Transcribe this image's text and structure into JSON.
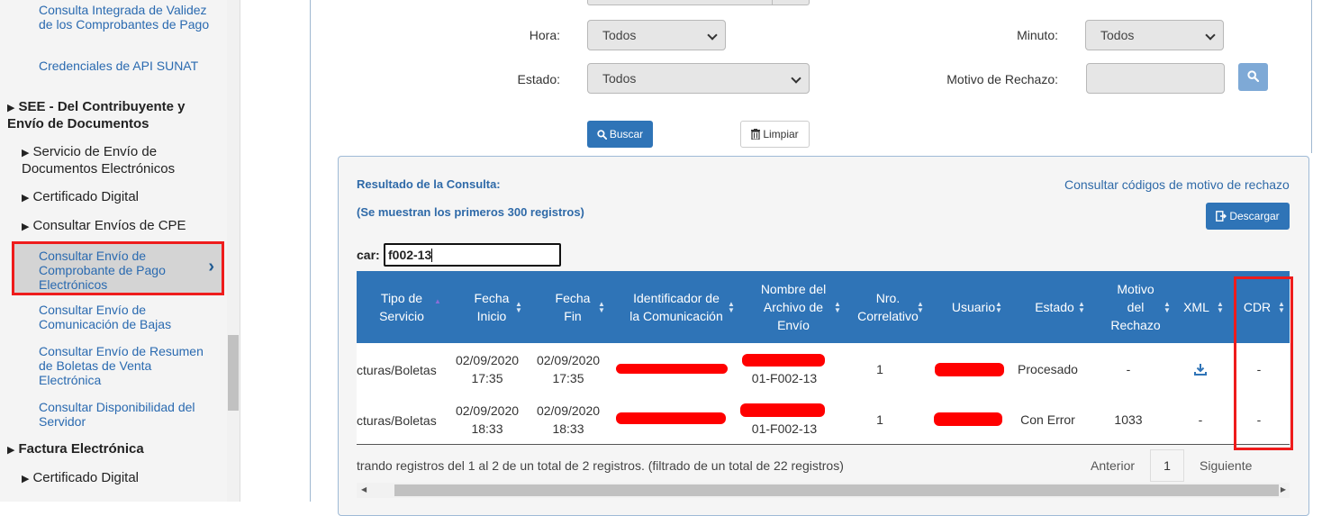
{
  "sidebar": {
    "link_validez": "Consulta Integrada de Validez de los Comprobantes de Pago",
    "link_credenciales": "Credenciales de API SUNAT",
    "section_see": "SEE - Del Contribuyente y Envío de Documentos",
    "item_servicio": "Servicio de Envío de Documentos Electrónicos",
    "item_certificado": "Certificado Digital",
    "item_consultar_envios": "Consultar Envíos de CPE",
    "active_item": "Consultar Envío de Comprobante de Pago Electrónicos",
    "link_bajas": "Consultar Envío de Comunicación de Bajas",
    "link_resumen": "Consultar Envío de Resumen de Boletas de Venta Electrónica",
    "link_disponibilidad": "Consultar Disponibilidad del Servidor",
    "section_factura": "Factura Electrónica",
    "item_certificado2": "Certificado Digital"
  },
  "filters": {
    "hora_label": "Hora:",
    "hora_value": "Todos",
    "minuto_label": "Minuto:",
    "minuto_value": "Todos",
    "estado_label": "Estado:",
    "estado_value": "Todos",
    "motivo_label": "Motivo de Rechazo:",
    "motivo_value": "",
    "buscar": "Buscar",
    "limpiar": "Limpiar"
  },
  "results": {
    "title": "Resultado de la Consulta:",
    "subtitle": "(Se muestran los primeros 300 registros)",
    "codes_link": "Consultar códigos de motivo de rechazo",
    "download": "Descargar",
    "search_label": "car:",
    "search_value": "f002-13",
    "columns": [
      "Tipo de Servicio",
      "Fecha Inicio",
      "Fecha Fin",
      "Identificador de la Comunicación",
      "Nombre del Archivo de Envío",
      "Nro. Correlativo",
      "Usuario",
      "Estado",
      "Motivo del Rechazo",
      "XML",
      "CDR"
    ],
    "rows": [
      {
        "tipo": "cturas/Boletas",
        "inicio_date": "02/09/2020",
        "inicio_time": "17:35",
        "fin_date": "02/09/2020",
        "fin_time": "17:35",
        "archivo_suffix": "01-F002-13",
        "correlativo": "1",
        "estado": "Procesado",
        "motivo": "-",
        "xml": "download-icon",
        "cdr": "-"
      },
      {
        "tipo": "cturas/Boletas",
        "inicio_date": "02/09/2020",
        "inicio_time": "18:33",
        "fin_date": "02/09/2020",
        "fin_time": "18:33",
        "archivo_suffix": "01-F002-13",
        "correlativo": "1",
        "estado": "Con Error",
        "motivo": "1033",
        "xml": "-",
        "cdr": "-"
      }
    ],
    "footer_info": "trando registros del 1 al 2 de un total de 2 registros. (filtrado de un total de 22 registros)",
    "pager_prev": "Anterior",
    "pager_page": "1",
    "pager_next": "Siguiente"
  },
  "colors": {
    "header_blue": "#2f74b7",
    "link_blue": "#2a6ab0",
    "highlight_red": "#ee1c1c"
  }
}
